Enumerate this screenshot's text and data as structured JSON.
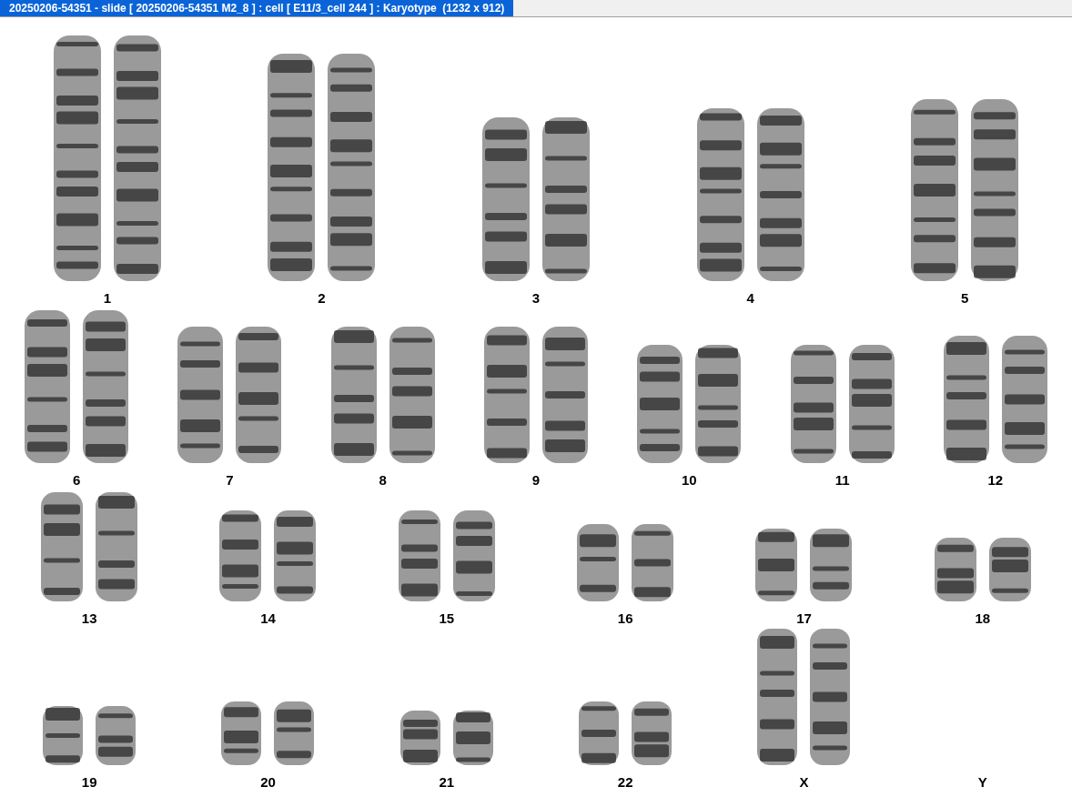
{
  "window": {
    "title": "20250206-54351 - slide [ 20250206-54351 M2_8 ] : cell [ E11/3_cell 244 ] : Karyotype  (1232 x 912)"
  },
  "karyotype": {
    "rows": [
      [
        {
          "label": "1",
          "kind": "pair"
        },
        {
          "label": "2",
          "kind": "pair"
        },
        {
          "label": "3",
          "kind": "pair"
        },
        {
          "label": "4",
          "kind": "pair"
        },
        {
          "label": "5",
          "kind": "pair"
        }
      ],
      [
        {
          "label": "6",
          "kind": "pair"
        },
        {
          "label": "7",
          "kind": "pair"
        },
        {
          "label": "8",
          "kind": "pair"
        },
        {
          "label": "9",
          "kind": "pair"
        },
        {
          "label": "10",
          "kind": "pair"
        },
        {
          "label": "11",
          "kind": "pair"
        },
        {
          "label": "12",
          "kind": "pair"
        }
      ],
      [
        {
          "label": "13",
          "kind": "pair"
        },
        {
          "label": "14",
          "kind": "pair"
        },
        {
          "label": "15",
          "kind": "pair"
        },
        {
          "label": "16",
          "kind": "pair"
        },
        {
          "label": "17",
          "kind": "pair"
        },
        {
          "label": "18",
          "kind": "pair"
        }
      ],
      [
        {
          "label": "19",
          "kind": "pair"
        },
        {
          "label": "20",
          "kind": "pair"
        },
        {
          "label": "21",
          "kind": "pair"
        },
        {
          "label": "22",
          "kind": "pair"
        },
        {
          "label": "X",
          "kind": "pair"
        },
        {
          "label": "Y",
          "kind": "empty"
        }
      ]
    ]
  }
}
